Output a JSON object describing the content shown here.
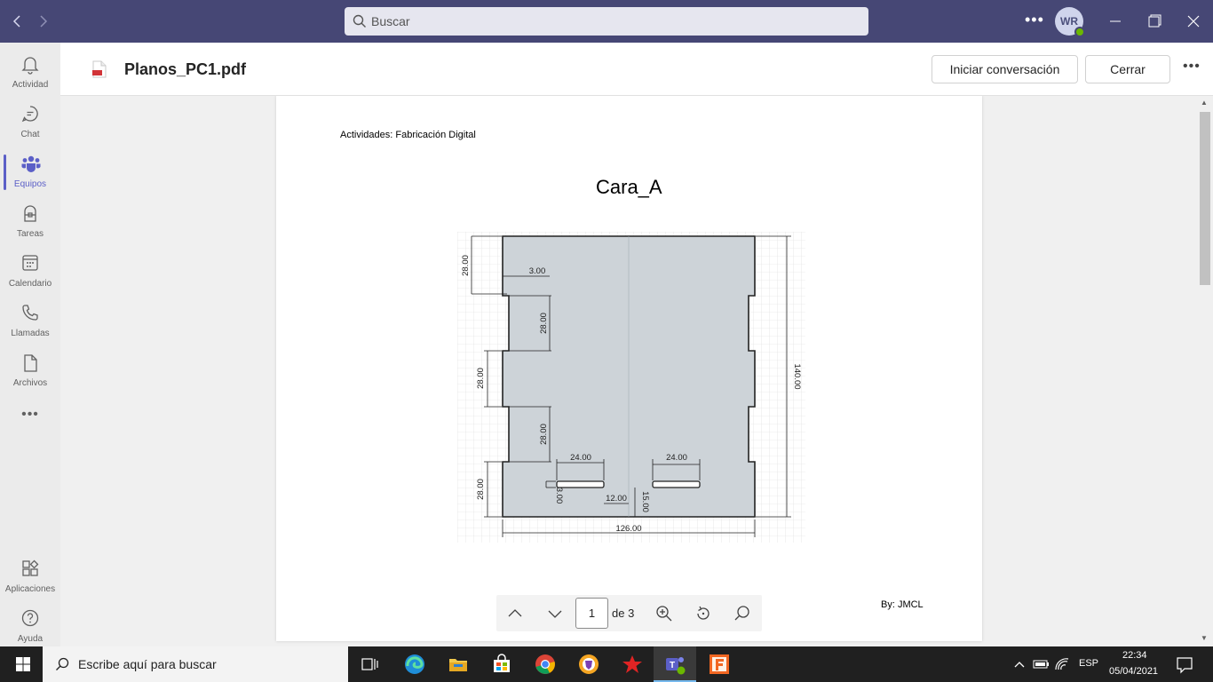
{
  "titlebar": {
    "search_placeholder": "Buscar",
    "avatar_initials": "WR"
  },
  "rail": {
    "items": [
      {
        "label": "Actividad",
        "icon": "bell-icon"
      },
      {
        "label": "Chat",
        "icon": "chat-icon"
      },
      {
        "label": "Equipos",
        "icon": "teams-icon",
        "active": true
      },
      {
        "label": "Tareas",
        "icon": "tasks-icon"
      },
      {
        "label": "Calendario",
        "icon": "calendar-icon"
      },
      {
        "label": "Llamadas",
        "icon": "phone-icon"
      },
      {
        "label": "Archivos",
        "icon": "file-icon"
      }
    ],
    "bottom": [
      {
        "label": "Aplicaciones",
        "icon": "apps-icon"
      },
      {
        "label": "Ayuda",
        "icon": "help-icon"
      }
    ]
  },
  "header": {
    "file_title": "Planos_PC1.pdf",
    "start_conversation": "Iniciar conversación",
    "close": "Cerrar"
  },
  "document": {
    "header_text": "Actividades: Fabricación Digital",
    "title": "Cara_A",
    "author": "By: JMCL",
    "dimensions": {
      "top_notch_height": "28.00",
      "notch_depth": "3.00",
      "slot_spacing_1": "28.00",
      "left_middle": "28.00",
      "slot_spacing_2": "28.00",
      "bottom_left": "28.00",
      "slot_width_left": "24.00",
      "slot_width_right": "24.00",
      "slot_height": "3.00",
      "slot_gap": "12.00",
      "slot_offset": "15.00",
      "total_width": "126.00",
      "total_height": "140.00"
    }
  },
  "pager": {
    "current_page": "1",
    "of_text": "de 3"
  },
  "taskbar": {
    "search_placeholder": "Escribe aquí para buscar",
    "language": "ESP",
    "time": "22:34",
    "date": "05/04/2021"
  },
  "colors": {
    "titlebar": "#464775",
    "accent": "#5b5fc7",
    "drawing_fill": "#cdd3d8"
  }
}
